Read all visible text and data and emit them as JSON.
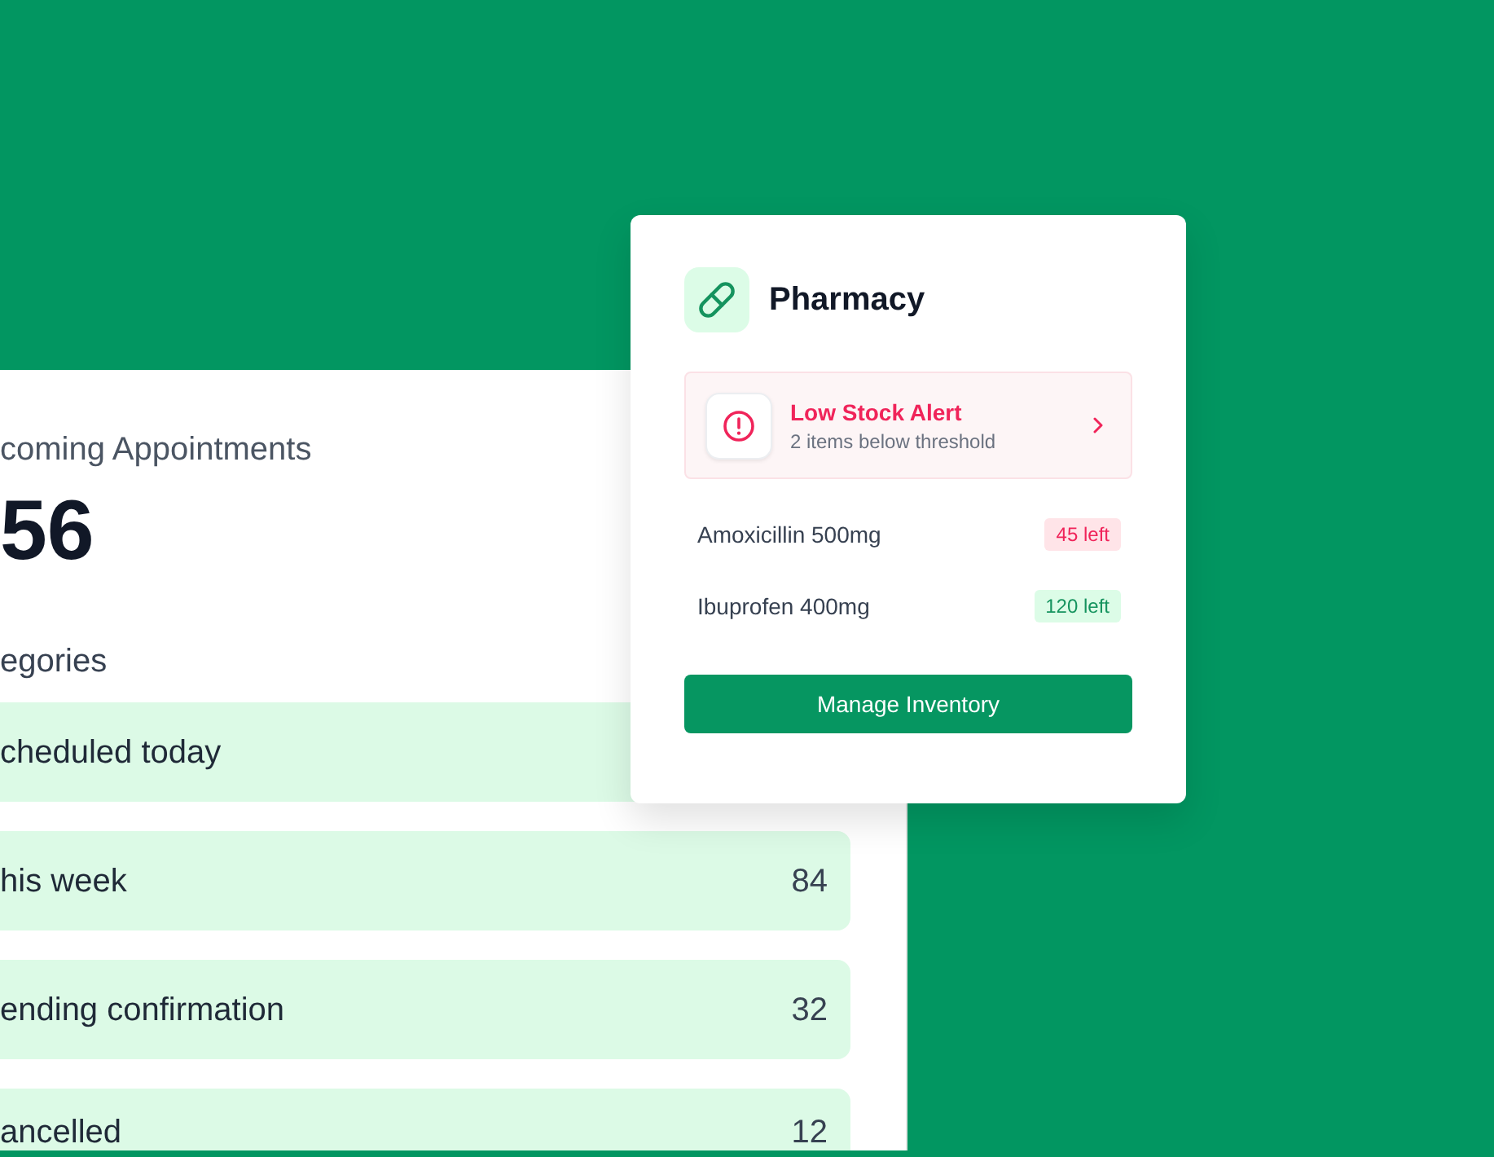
{
  "overview": {
    "title": "coming Appointments",
    "total": "56",
    "section_label": "egories",
    "categories": [
      {
        "label": "cheduled today"
      },
      {
        "label": "his week",
        "count": "84"
      },
      {
        "label": "ending confirmation",
        "count": "32"
      },
      {
        "label": "ancelled",
        "count": "12"
      }
    ]
  },
  "pharmacy": {
    "title": "Pharmacy",
    "alert": {
      "title": "Low Stock Alert",
      "subtitle": "2 items below threshold"
    },
    "items": [
      {
        "name": "Amoxicillin 500mg",
        "stock": "45 left",
        "low_stock": true
      },
      {
        "name": "Ibuprofen 400mg",
        "stock": "120 left",
        "low_stock": false
      }
    ],
    "button": "Manage Inventory"
  }
}
